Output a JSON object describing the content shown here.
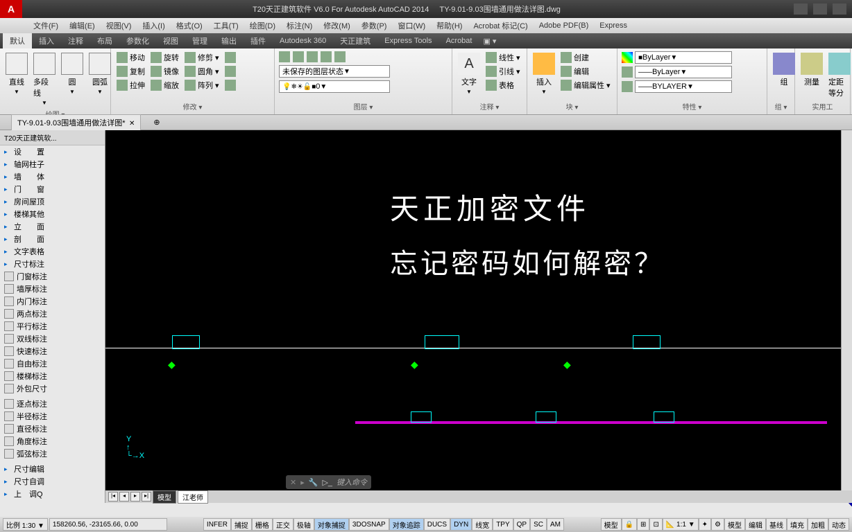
{
  "title": {
    "app": "T20天正建筑软件 V6.0 For Autodesk AutoCAD 2014",
    "file": "TY-9.01-9.03围墙通用做法详图.dwg"
  },
  "menubar": [
    "文件(F)",
    "编辑(E)",
    "视图(V)",
    "插入(I)",
    "格式(O)",
    "工具(T)",
    "绘图(D)",
    "标注(N)",
    "修改(M)",
    "参数(P)",
    "窗口(W)",
    "帮助(H)",
    "Acrobat 标记(C)",
    "Adobe PDF(B)",
    "Express"
  ],
  "ribbontabs": [
    "默认",
    "插入",
    "注释",
    "布局",
    "参数化",
    "视图",
    "管理",
    "输出",
    "插件",
    "Autodesk 360",
    "天正建筑",
    "Express Tools",
    "Acrobat"
  ],
  "panels": {
    "draw": {
      "label": "绘图 ▾",
      "items": [
        "直线",
        "多段线",
        "圆",
        "圆弧"
      ]
    },
    "modify": {
      "label": "修改 ▾",
      "move": "移动",
      "rotate": "旋转",
      "trim": "修剪",
      "copy": "复制",
      "mirror": "镜像",
      "fillet": "圆角",
      "stretch": "拉伸",
      "scale": "缩放",
      "array": "阵列"
    },
    "layer": {
      "label": "图层 ▾",
      "unsaved": "未保存的图层状态",
      "cur": "0"
    },
    "anno": {
      "label": "注释 ▾",
      "text": "文字",
      "line": "线性",
      "lead": "引线",
      "tab": "表格"
    },
    "block": {
      "label": "块 ▾",
      "ins": "插入",
      "create": "创建",
      "edit": "编辑",
      "attr": "编辑属性 ▾"
    },
    "prop": {
      "label": "特性 ▾",
      "c": "ByLayer",
      "lt": "ByLayer",
      "lw": "BYLAYER"
    },
    "grp": {
      "label": "组 ▾",
      "g": "组"
    },
    "util": {
      "label": "实用工",
      "m": "测量",
      "d": "定距等分"
    }
  },
  "filetab": "TY-9.01-9.03围墙通用做法详图*",
  "sidebar": {
    "header": "T20天正建筑软...",
    "tree": [
      "设　　置",
      "轴网柱子",
      "墙　　体",
      "门　　窗",
      "房间屋顶",
      "楼梯其他",
      "立　　面",
      "剖　　面",
      "文字表格",
      "尺寸标注"
    ],
    "tools": [
      "门窗标注",
      "墙厚标注",
      "内门标注",
      "两点标注",
      "平行标注",
      "双线标注",
      "快速标注",
      "自由标注",
      "楼梯标注",
      "外包尺寸"
    ],
    "tools2": [
      "逐点标注",
      "半径标注",
      "直径标注",
      "角度标注",
      "弧弦标注"
    ],
    "tools3": [
      "尺寸编辑",
      "尺寸自调",
      "上　调Q"
    ]
  },
  "canvas": {
    "t1": "天正加密文件",
    "t2": "忘记密码如何解密？"
  },
  "modeltabs": {
    "model": "模型",
    "layout": "江老师"
  },
  "cmd": "键入命令",
  "status": {
    "scale": "比例 1:30 ▼",
    "coords": "158260.56, -23165.66, 0.00",
    "toggles": [
      "INFER",
      "捕捉",
      "栅格",
      "正交",
      "极轴",
      "对象捕捉",
      "3DOSNAP",
      "对象追踪",
      "DUCS",
      "DYN",
      "线宽",
      "TPY",
      "QP",
      "SC",
      "AM"
    ],
    "active": [
      "对象捕捉",
      "对象追踪",
      "DYN"
    ],
    "right": [
      "模型",
      "编辑",
      "基线",
      "填充",
      "加粗",
      "动态"
    ],
    "annoscale": "1:1"
  }
}
